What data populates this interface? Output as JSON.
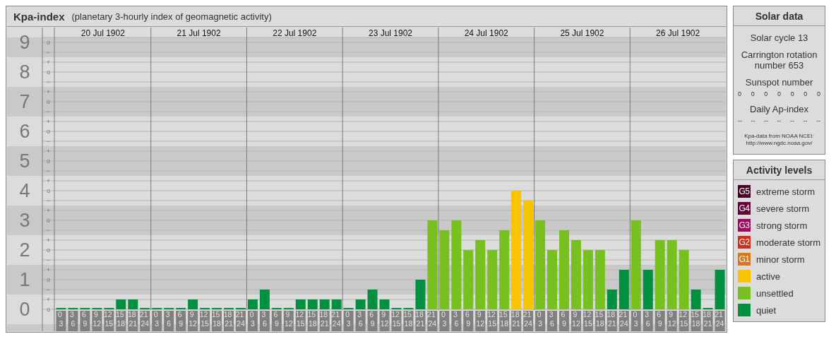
{
  "panel": {
    "title": "Kpa-index",
    "subtitle": "(planetary 3-hourly index of geomagnetic activity)"
  },
  "chart": {
    "days": [
      "20 Jul 1902",
      "21 Jul 1902",
      "22 Jul 1902",
      "23 Jul 1902",
      "24 Jul 1902",
      "25 Jul 1902",
      "26 Jul 1902"
    ],
    "sublevel_marks": [
      "o",
      "−",
      "+",
      "o",
      "−",
      "+",
      "o",
      "−",
      "+",
      "o",
      "−",
      "+",
      "o",
      "−",
      "+",
      "o",
      "−",
      "+",
      "o",
      "−",
      "+",
      "o",
      "−",
      "+",
      "o",
      "−",
      "+",
      "o"
    ],
    "chart_data": {
      "type": "bar",
      "stacked": true,
      "grid": true,
      "ylim": [
        0,
        9
      ],
      "yticks": [
        0,
        1,
        2,
        3,
        4,
        5,
        6,
        7,
        8,
        9
      ],
      "categories": [
        "0 3",
        "3 6",
        "6 9",
        "9 12",
        "12 15",
        "15 18",
        "18 21",
        "21 24",
        "0 3",
        "3 6",
        "6 9",
        "9 12",
        "12 15",
        "15 18",
        "18 21",
        "21 24",
        "0 3",
        "3 6",
        "6 9",
        "9 12",
        "12 15",
        "15 18",
        "18 21",
        "21 24",
        "0 3",
        "3 6",
        "6 9",
        "9 12",
        "12 15",
        "15 18",
        "18 21",
        "21 24",
        "0 3",
        "3 6",
        "6 9",
        "9 12",
        "12 15",
        "15 18",
        "18 21",
        "21 24",
        "0 3",
        "3 6",
        "6 9",
        "9 12",
        "12 15",
        "15 18",
        "18 21",
        "21 24",
        "0 3",
        "3 6",
        "6 9",
        "9 12",
        "12 15",
        "15 18",
        "18 21",
        "21 24"
      ],
      "series": [
        {
          "name": "quiet",
          "color": "#009040",
          "values": [
            0,
            0,
            0,
            0,
            0,
            0.33,
            0.33,
            0,
            0,
            0,
            0,
            0.33,
            0,
            0,
            0,
            0,
            0.33,
            0.67,
            0,
            0,
            0.33,
            0.33,
            0.33,
            0.33,
            0,
            0.33,
            0.67,
            0.33,
            0,
            0,
            1,
            null,
            null,
            null,
            null,
            null,
            null,
            null,
            null,
            null,
            null,
            null,
            null,
            null,
            null,
            null,
            0.67,
            1.33,
            null,
            1.33,
            null,
            null,
            null,
            0.67,
            0,
            1.33
          ]
        },
        {
          "name": "unsettled",
          "color": "#78c020",
          "values": [
            null,
            null,
            null,
            null,
            null,
            null,
            null,
            null,
            null,
            null,
            null,
            null,
            null,
            null,
            null,
            null,
            null,
            null,
            null,
            null,
            null,
            null,
            null,
            null,
            null,
            null,
            null,
            null,
            null,
            null,
            null,
            3,
            2.67,
            3,
            2,
            2.33,
            2,
            2.67,
            null,
            null,
            3,
            2,
            2.67,
            2.33,
            2,
            2,
            null,
            null,
            3,
            null,
            2.33,
            2.33,
            2,
            null,
            null,
            null
          ]
        },
        {
          "name": "active",
          "color": "#f8c400",
          "values": [
            null,
            null,
            null,
            null,
            null,
            null,
            null,
            null,
            null,
            null,
            null,
            null,
            null,
            null,
            null,
            null,
            null,
            null,
            null,
            null,
            null,
            null,
            null,
            null,
            null,
            null,
            null,
            null,
            null,
            null,
            null,
            null,
            null,
            null,
            null,
            null,
            null,
            null,
            4,
            3.67,
            null,
            null,
            null,
            null,
            null,
            null,
            null,
            null,
            null,
            null,
            null,
            null,
            null,
            null,
            null,
            null
          ]
        }
      ]
    }
  },
  "solar_data": {
    "title": "Solar data",
    "solar_cycle": "Solar cycle 13",
    "carrington_rotation": "Carrington rotation number 653",
    "sunspot_label": "Sunspot number",
    "sunspot_numbers": [
      "0",
      "0",
      "0",
      "0",
      "0",
      "0",
      "0"
    ],
    "ap_label": "Daily Ap-index",
    "ap_values": [
      "--",
      "--",
      "--",
      "--",
      "--",
      "--",
      "--"
    ],
    "source": [
      "Kpa-data from NOAA NCEI:",
      "http://www.ngdc.noaa.gov/"
    ]
  },
  "activity_levels": {
    "title": "Activity levels",
    "items": [
      {
        "code": "G5",
        "label": "extreme storm",
        "color": "#4a0024"
      },
      {
        "code": "G4",
        "label": "severe storm",
        "color": "#6a003a"
      },
      {
        "code": "G3",
        "label": "strong storm",
        "color": "#a8005c"
      },
      {
        "code": "G2",
        "label": "moderate storm",
        "color": "#d42c1a"
      },
      {
        "code": "G1",
        "label": "minor storm",
        "color": "#e27418"
      }
    ]
  }
}
